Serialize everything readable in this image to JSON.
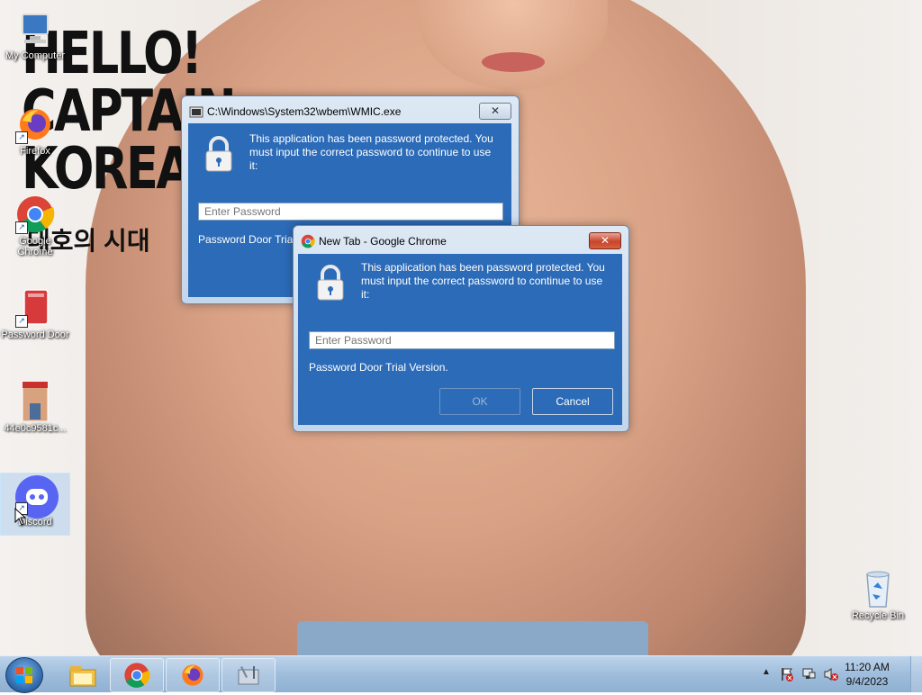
{
  "wallpaper": {
    "poster_lines": [
      "HELLO!",
      "CAPTAIN",
      "KOREA"
    ],
    "poster_subtitle": "대호의 시대"
  },
  "desktop_icons": [
    {
      "label": "My Computer",
      "icon": "computer-icon"
    },
    {
      "label": "Firefox",
      "icon": "firefox-icon"
    },
    {
      "label": "Google Chrome",
      "icon": "chrome-icon"
    },
    {
      "label": "Password Door",
      "icon": "password-door-icon"
    },
    {
      "label": "44e0c9581c...",
      "icon": "image-file-icon"
    },
    {
      "label": "Discord",
      "icon": "discord-icon"
    },
    {
      "label": "Recycle Bin",
      "icon": "recycle-bin-icon"
    }
  ],
  "dialog_back": {
    "title": "C:\\Windows\\System32\\wbem\\WMIC.exe",
    "message": "This application has been password protected. You must input the correct password to continue to use it:",
    "placeholder": "Enter Password",
    "trial_text": "Password Door Trial"
  },
  "dialog_front": {
    "title": "New Tab - Google Chrome",
    "message": "This application has been password protected. You must input the correct password to continue to use it:",
    "placeholder": "Enter Password",
    "trial_text": "Password Door Trial Version.",
    "ok_label": "OK",
    "cancel_label": "Cancel"
  },
  "taskbar": {
    "apps": [
      "file-explorer-icon",
      "chrome-icon",
      "firefox-icon",
      "tools-icon"
    ],
    "time": "11:20 AM",
    "date": "9/4/2023"
  },
  "colors": {
    "dialog_blue": "#2c6bb8",
    "taskbar": "#a8c4e0"
  }
}
